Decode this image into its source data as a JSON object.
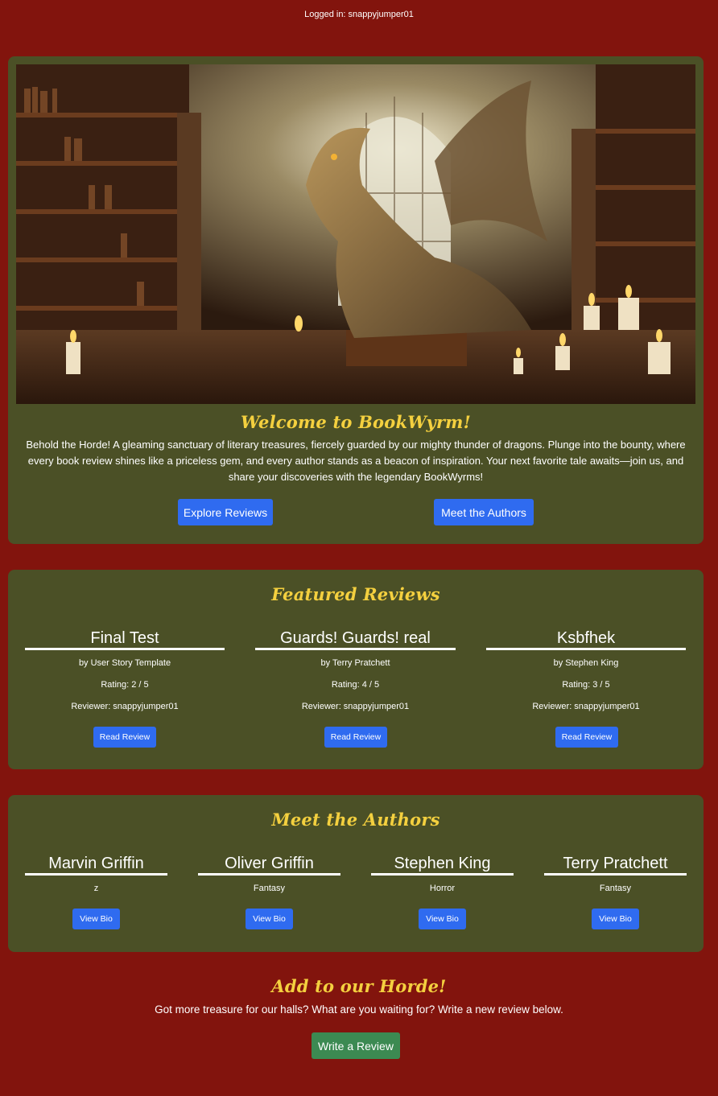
{
  "header": {
    "login_status": "Logged in: snappyjumper01"
  },
  "hero": {
    "image_description": "dragon-in-library",
    "title": "Welcome to BookWyrm!",
    "text": "Behold the Horde! A gleaming sanctuary of literary treasures, fiercely guarded by our mighty thunder of dragons. Plunge into the bounty, where every book review shines like a priceless gem, and every author stands as a beacon of inspiration. Your next favorite tale awaits—join us, and share your discoveries with the legendary BookWyrms!",
    "explore_label": "Explore Reviews",
    "meet_label": "Meet the Authors"
  },
  "featured": {
    "title": "Featured Reviews",
    "reviews": [
      {
        "title": "Final Test",
        "author": "by User Story Template",
        "rating": "Rating: 2 / 5",
        "reviewer": "Reviewer: snappyjumper01",
        "button": "Read Review"
      },
      {
        "title": "Guards! Guards! real",
        "author": "by Terry Pratchett",
        "rating": "Rating: 4 / 5",
        "reviewer": "Reviewer: snappyjumper01",
        "button": "Read Review"
      },
      {
        "title": "Ksbfhek",
        "author": "by Stephen King",
        "rating": "Rating: 3 / 5",
        "reviewer": "Reviewer: snappyjumper01",
        "button": "Read Review"
      }
    ]
  },
  "authors": {
    "title": "Meet the Authors",
    "list": [
      {
        "name": "Marvin Griffin",
        "genre": "z",
        "button": "View Bio"
      },
      {
        "name": "Oliver Griffin",
        "genre": "Fantasy",
        "button": "View Bio"
      },
      {
        "name": "Stephen King",
        "genre": "Horror",
        "button": "View Bio"
      },
      {
        "name": "Terry Pratchett",
        "genre": "Fantasy",
        "button": "View Bio"
      }
    ]
  },
  "cta": {
    "title": "Add to our Horde!",
    "text": "Got more treasure for our halls? What are you waiting for? Write a new review below.",
    "button": "Write a Review"
  },
  "colors": {
    "background": "#82140d",
    "panel": "#4b5026",
    "accent_title": "#f4d03f",
    "button_blue": "#2f6bf0",
    "button_green": "#3c8a52"
  }
}
